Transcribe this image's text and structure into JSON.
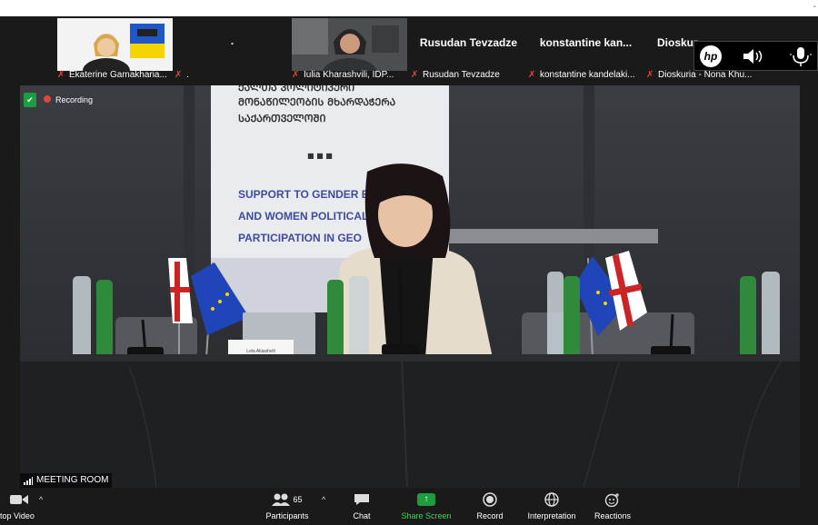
{
  "topbar": {
    "dash": "-"
  },
  "gallery": {
    "tiles": [
      {
        "name": "Ekaterine Gamakharia..."
      },
      {
        "name": "."
      },
      {
        "name": "Iulia Kharashvili, IDP..."
      },
      {
        "name": "Rusudan Tevzadze",
        "big": "Rusudan Tevzadze"
      },
      {
        "name": "konstantine kandelaki...",
        "big": "konstantine  kan..."
      },
      {
        "name": "Dioskuria - Nona Khu...",
        "big": "Dioskur"
      }
    ],
    "extra_dot": "."
  },
  "hp_overlay": {
    "logo": "hp"
  },
  "status": {
    "recording": "Recording"
  },
  "scene": {
    "banner_georgian_1": "ᲥᲐᲚᲗᲐ ᲞᲝᲚᲘᲢᲘᲙᲣᲠᲘ",
    "banner_georgian_2": "ᲛᲝᲜᲐᲬᲘᲚᲔᲝᲑᲘᲡ ᲛᲮᲐᲠᲓᲐᲭᲔᲠᲐ",
    "banner_georgian_3": "ᲡᲐᲥᲐᲠᲗᲕᲔᲚᲝᲨᲘ",
    "banner_dots": "■   ■   ■",
    "banner_en_1": "SUPPORT TO GENDER EQ",
    "banner_en_2": "AND WOMEN POLITICAL",
    "banner_en_3": "PARTICIPATION IN GEO",
    "nameplate": "Lela Akiashvili"
  },
  "meeting_label": "MEETING ROOM",
  "toolbar": {
    "stop_video": "top Video",
    "participants": "Participants",
    "participant_count": "65",
    "chat": "Chat",
    "share_screen": "Share Screen",
    "record": "Record",
    "interpretation": "Interpretation",
    "reactions": "Reactions"
  },
  "colors": {
    "accent": "#1d9d3f",
    "muted_mic": "#e0453c",
    "background": "#1a1a1a"
  }
}
